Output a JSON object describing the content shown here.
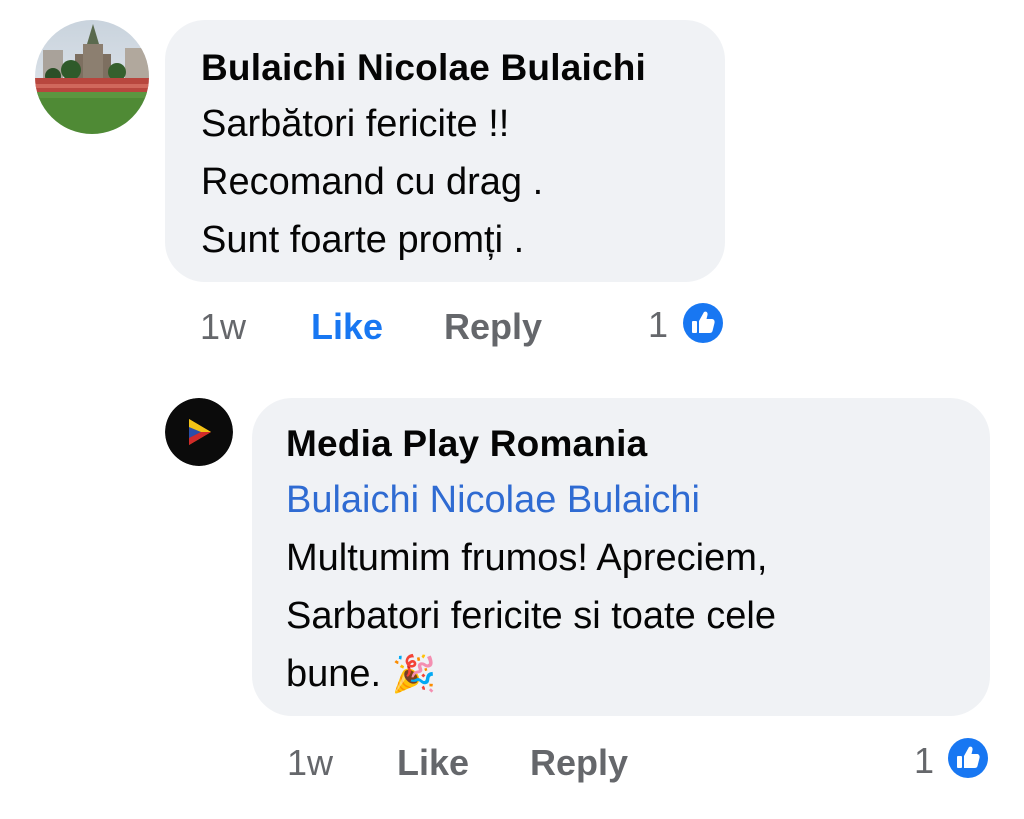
{
  "comment": {
    "author": "Bulaichi Nicolae Bulaichi",
    "lines": [
      "Sarbători fericite  !!",
      "Recomand cu drag .",
      "Sunt foarte promți ."
    ],
    "time": "1w",
    "like_label": "Like",
    "reply_label": "Reply",
    "reaction_count": "1",
    "like_active": true,
    "colors": {
      "bubble": "#f0f2f5",
      "like_blue": "#1877f2",
      "meta_gray": "#65676b"
    }
  },
  "reply": {
    "author": "Media Play Romania",
    "mention": "Bulaichi Nicolae Bulaichi",
    "lines": [
      "Multumim frumos! Apreciem,",
      "Sarbatori fericite si toate cele",
      "bune."
    ],
    "emoji": "🎉",
    "time": "1w",
    "like_label": "Like",
    "reply_label": "Reply",
    "reaction_count": "1",
    "colors": {
      "mention": "#2f6bd2"
    }
  },
  "icons": {
    "reaction": "thumbs-up-icon",
    "avatar_logo": "play-triangle-icon"
  }
}
